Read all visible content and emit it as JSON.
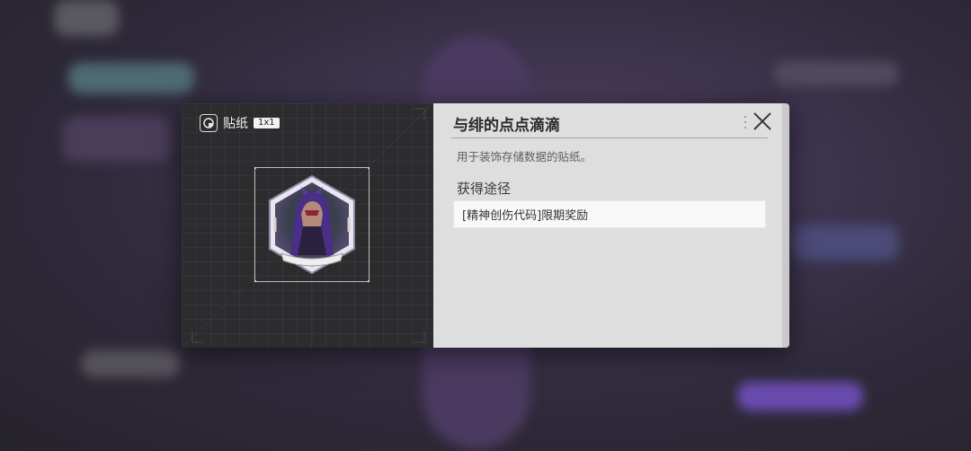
{
  "dialog": {
    "item_type": "贴纸",
    "item_size": "1x1",
    "item_title": "与绯的点点滴滴",
    "description": "用于装饰存储数据的贴纸。",
    "acquire_heading": "获得途径",
    "acquire_source": "[精神创伤代码]限期奖励"
  },
  "icons": {
    "type": "sticker-icon",
    "close": "close-icon",
    "sticker": "hooded-figure-sticker"
  },
  "colors": {
    "left_panel": "#2c2c2e",
    "right_panel": "#dedede",
    "sticker_accent": "#5b3f9a"
  }
}
